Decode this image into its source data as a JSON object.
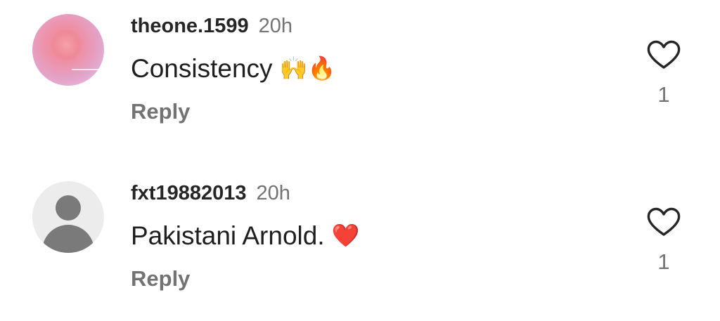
{
  "comments": [
    {
      "username": "theone.1599",
      "time": "20h",
      "text": "Consistency",
      "emojis": [
        "🙌",
        "🔥"
      ],
      "reply_label": "Reply",
      "like_count": "1",
      "avatar": "profile-photo"
    },
    {
      "username": "fxt19882013",
      "time": "20h",
      "text": "Pakistani Arnold.",
      "emojis": [
        "❤️"
      ],
      "reply_label": "Reply",
      "like_count": "1",
      "avatar": "default-avatar"
    }
  ],
  "colors": {
    "primary_text": "#262626",
    "secondary_text": "#737373",
    "heart_red": "#e8232f",
    "background": "#ffffff"
  },
  "icons": {
    "like": "heart-outline-icon",
    "default_avatar": "person-silhouette-icon"
  }
}
